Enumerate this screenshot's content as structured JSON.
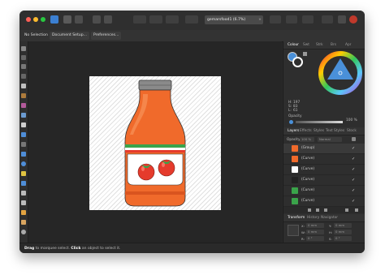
{
  "document_tab": {
    "title": "gemarsfood1 (6.7%)",
    "close_glyph": "×"
  },
  "context_toolbar": {
    "selection_label": "No Selection",
    "document_setup_label": "Document Setup...",
    "preferences_label": "Preferences..."
  },
  "colors": {
    "accent": "#4a90d9",
    "window_bg": "#2b2b2b",
    "canvas_bg": "#262626",
    "bottle_orange": "#f06a2b",
    "cap_gray": "#8a8a8a",
    "tomato_red": "#e53b2c",
    "stripe_green": "#3aa34a"
  },
  "color_panel": {
    "tabs": [
      "Colour",
      "Swatches",
      "Stroke",
      "Brushes",
      "Appearance"
    ],
    "tab_abbrev": [
      "Colour",
      "Swt",
      "Strk",
      "Brs",
      "Apr"
    ],
    "hsl": [
      {
        "k": "H:",
        "v": "197"
      },
      {
        "k": "S:",
        "v": "83"
      },
      {
        "k": "L:",
        "v": "61"
      }
    ],
    "opacity_label": "Opacity",
    "opacity_value": "100 %"
  },
  "layers_panel": {
    "tabs": [
      "Layers",
      "Effects",
      "Styles",
      "Text Styles",
      "Stock"
    ],
    "opacity_label": "Opacity:",
    "opacity_value": "100 %",
    "blend_mode": "Normal",
    "rows": [
      {
        "name": "(Group)",
        "check": "✓"
      },
      {
        "name": "(Curve)",
        "check": "✓"
      },
      {
        "name": "(Curve)",
        "check": "✓"
      },
      {
        "name": "(Curve)",
        "check": "✓"
      },
      {
        "name": "(Curve)",
        "check": "✓"
      },
      {
        "name": "(Curve)",
        "check": "✓"
      }
    ]
  },
  "transform_panel": {
    "tabs": [
      "Transform",
      "History",
      "Navigator"
    ],
    "fields": [
      {
        "label": "X:",
        "value": "0 mm"
      },
      {
        "label": "Y:",
        "value": "0 mm"
      },
      {
        "label": "W:",
        "value": "0 mm"
      },
      {
        "label": "H:",
        "value": "0 mm"
      },
      {
        "label": "R:",
        "value": "0 °"
      },
      {
        "label": "S:",
        "value": "0 °"
      }
    ]
  },
  "status": {
    "drag_word": "Drag",
    "drag_rest": " to marquee select. ",
    "click_word": "Click",
    "click_rest": " an object to select it."
  }
}
